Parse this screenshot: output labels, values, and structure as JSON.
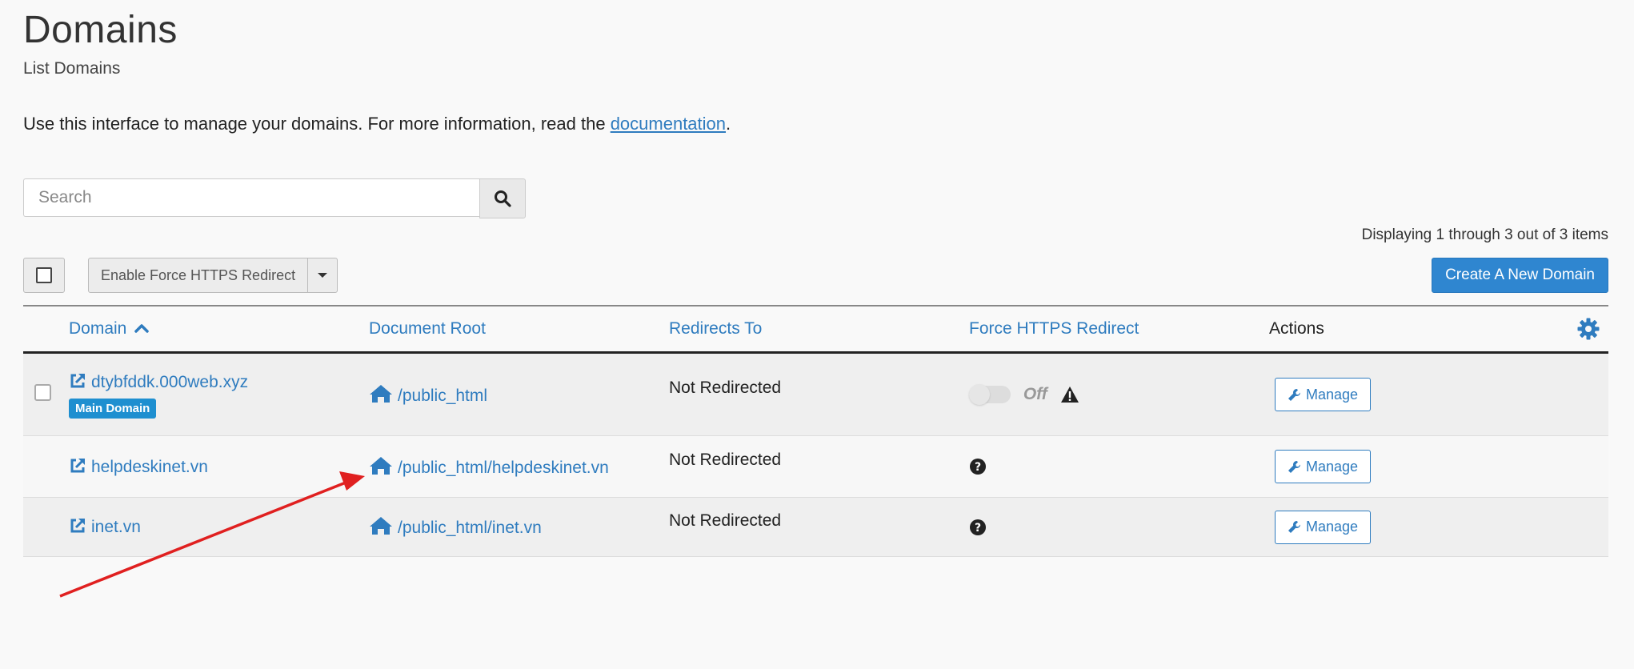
{
  "header": {
    "title": "Domains",
    "subtitle": "List Domains",
    "intro_prefix": "Use this interface to manage your domains. For more information, read the ",
    "intro_link": "documentation",
    "intro_suffix": "."
  },
  "search": {
    "placeholder": "Search",
    "value": ""
  },
  "pagination": {
    "summary": "Displaying 1 through 3 out of 3 items"
  },
  "toolbar": {
    "bulk_action_label": "Enable Force HTTPS Redirect",
    "create_label": "Create A New Domain"
  },
  "table": {
    "columns": {
      "domain": "Domain",
      "document_root": "Document Root",
      "redirects_to": "Redirects To",
      "force_https": "Force HTTPS Redirect",
      "actions": "Actions"
    },
    "sort_indicator": "ascending",
    "rows": [
      {
        "domain": "dtybfddk.000web.xyz",
        "badge": "Main Domain",
        "document_root": "/public_html",
        "redirects_to": "Not Redirected",
        "force_https_state": "Off",
        "action_label": "Manage"
      },
      {
        "domain": "helpdeskinet.vn",
        "document_root": "/public_html/helpdeskinet.vn",
        "redirects_to": "Not Redirected",
        "action_label": "Manage"
      },
      {
        "domain": "inet.vn",
        "document_root": "/public_html/inet.vn",
        "redirects_to": "Not Redirected",
        "action_label": "Manage"
      }
    ]
  },
  "colors": {
    "link": "#2f7cbf",
    "primary": "#2f86d0",
    "badge": "#1e8fd0",
    "annotation_arrow": "#e02020"
  },
  "icons": [
    "search-icon",
    "external-link-icon",
    "home-icon",
    "warning-icon",
    "question-icon",
    "wrench-icon",
    "gear-icon",
    "caret-down-icon",
    "sort-up-icon"
  ]
}
